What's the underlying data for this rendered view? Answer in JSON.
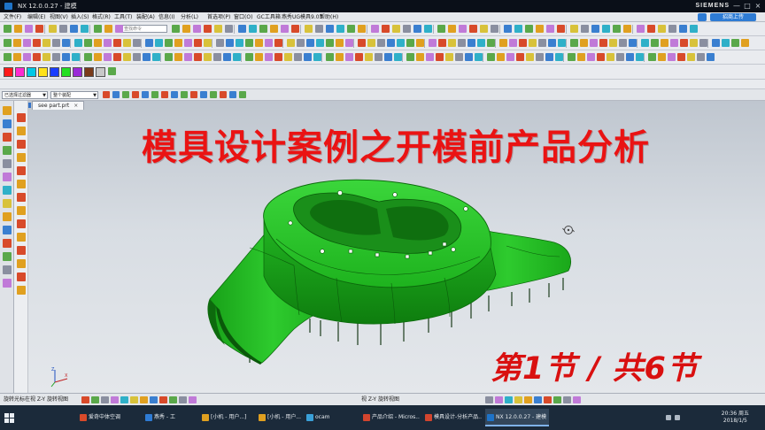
{
  "window": {
    "title": "NX 12.0.0.27 - 建模",
    "brand": "SIEMENS",
    "controls": [
      "—",
      "□",
      "×"
    ]
  },
  "menubar": {
    "items": [
      "文件(F)",
      "编辑(E)",
      "视图(V)",
      "插入(S)",
      "格式(R)",
      "工具(T)",
      "装配(A)",
      "信息(I)",
      "分析(L)",
      "首选项(P)",
      "窗口(O)",
      "GC工具箱",
      "燕秀UG模具9.03",
      "帮助(H)"
    ],
    "login_button": "招商上传"
  },
  "toolbar": {
    "search_placeholder": "查找命令"
  },
  "selection_bar": {
    "filter_value": "已选择过滤器",
    "scope_value": "整个装配"
  },
  "document_tab": {
    "label": "see part.prt",
    "close": "×"
  },
  "overlay": {
    "title": "模具设计案例之开模前产品分析",
    "lesson": "第1节 / 共6节"
  },
  "statusbar": {
    "prompt": "旋转光标在视 Z-Y 旋转视图",
    "status": "视 Z-Y 旋转视图"
  },
  "taskbar": {
    "apps": [
      {
        "label": "爱奇中体空调",
        "color": "#d94a2a"
      },
      {
        "label": "燕秀 - 工",
        "color": "#2e7bd4"
      },
      {
        "label": "[小机 - 用户...]",
        "color": "#e0a020"
      },
      {
        "label": "[小机 - 用户...]",
        "color": "#e0a020"
      },
      {
        "label": "ocam",
        "color": "#3aa0d8"
      },
      {
        "label": "产品介绍 - Micros...",
        "color": "#d2452e"
      },
      {
        "label": "模具设计-分析产品...",
        "color": "#d2452e"
      },
      {
        "label": "NX 12.0.0.27 - 建模",
        "color": "#1e73c8"
      }
    ],
    "time": "20:36",
    "day": "周五",
    "date": "2018/1/5"
  },
  "colors": {
    "title_red": "#ea1313",
    "part_green": "#1fbe1f",
    "taskbar_bg": "#1b2a3a"
  },
  "icons": {
    "cursor": "rotate-cursor-icon",
    "triad": "wcs-triad-icon"
  }
}
